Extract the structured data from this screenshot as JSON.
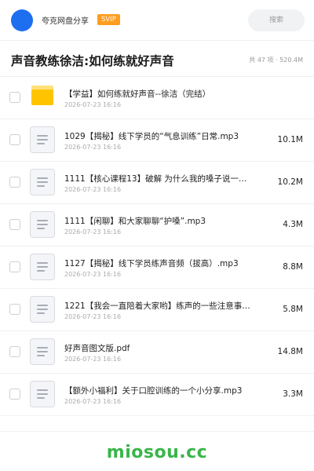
{
  "header": {
    "user_name": "夸克网盘分享",
    "vip_label": "SVIP",
    "search_placeholder": "搜索"
  },
  "folder": {
    "title": "声音教练徐洁:如何练就好声音",
    "meta": "共 47 项 · 520.4M"
  },
  "files": [
    {
      "type": "folder",
      "icon": "folder-icon",
      "name": "【学益】如何练就好声音--徐洁（完结）",
      "date": "2026-07-23 16:16",
      "size": ""
    },
    {
      "type": "file",
      "icon": "document-icon",
      "name": "1029【揭秘】线下学员的“气息训练”日常.mp3",
      "date": "2026-07-23 16:16",
      "size": "10.1M"
    },
    {
      "type": "file",
      "icon": "document-icon",
      "name": "1111【核心课程13】破解 为什么我的嗓子说一…",
      "date": "2026-07-23 16:16",
      "size": "10.2M"
    },
    {
      "type": "file",
      "icon": "document-icon",
      "name": "1111【闲聊】和大家聊聊“护嗓”.mp3",
      "date": "2026-07-23 16:16",
      "size": "4.3M"
    },
    {
      "type": "file",
      "icon": "document-icon",
      "name": "1127【揭秘】线下学员练声音频（拔高）.mp3",
      "date": "2026-07-23 16:16",
      "size": "8.8M"
    },
    {
      "type": "file",
      "icon": "document-icon",
      "name": "1221【我会一直陪着大家哟】练声的一些注意事项.…",
      "date": "2026-07-23 16:16",
      "size": "5.8M"
    },
    {
      "type": "file",
      "icon": "document-icon",
      "name": "好声音图文版.pdf",
      "date": "2026-07-23 16:16",
      "size": "14.8M"
    },
    {
      "type": "file",
      "icon": "document-icon",
      "name": "【额外小福利】关于口腔训练的一个小分享.mp3",
      "date": "2026-07-23 16:16",
      "size": "3.3M"
    }
  ],
  "watermark": "miosou.cc",
  "colors": {
    "avatar": "#1e6ff0",
    "vip_badge": "#ff9d1f",
    "folder": "#ffc400",
    "watermark": "#3ab54a"
  }
}
